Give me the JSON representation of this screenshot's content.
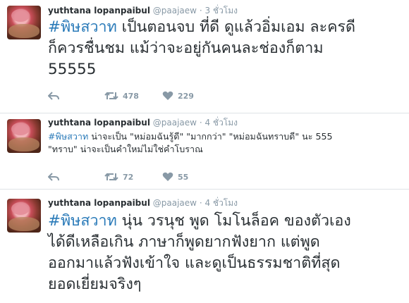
{
  "tweets": [
    {
      "name": "yuthtana lopanpaibul",
      "handle": "@paajaew",
      "time": "3 ชั่วโมง",
      "hashtag": "#พิษสวาท",
      "lines": [
        "เป็นตอนจบ ที่ดี ดูแล้วอิ่มเอม ละครดี",
        "ก็ควรชื่นชม แม้ว่าจะอยู่กันคนละช่องก็ตาม",
        "55555"
      ],
      "retweets": "478",
      "likes": "229",
      "icons": [
        "reply-icon",
        "retweet-icon",
        "heart-icon"
      ]
    },
    {
      "name": "yuthtana lopanpaibul",
      "handle": "@paajaew",
      "time": "4 ชั่วโมง",
      "hashtag": "#พิษสวาท",
      "lines": [
        "น่าจะเป็น \"หม่อมฉันรู้ดี\"  \"มากกว่า\" \"หม่อมฉันทราบดี\" นะ 555",
        "\"ทราบ\" น่าจะเป็นคำใหม่ไม่ใช่คำโบราณ"
      ],
      "retweets": "72",
      "likes": "55",
      "icons": [
        "reply-icon",
        "retweet-icon",
        "heart-icon"
      ]
    },
    {
      "name": "yuthtana lopanpaibul",
      "handle": "@paajaew",
      "time": "4 ชั่วโมง",
      "hashtag": "#พิษสวาท",
      "lines": [
        "นุ่น วรนุช พูด โมโนล็อค ของตัวเอง",
        "ได้ดีเหลือเกิน ภาษาก็พูดยากฟังยาก แต่พูด",
        "ออกมาแล้วฟังเข้าใจ และดูเป็นธรรมชาติที่สุด",
        "ยอดเยี่ยมจริงๆ"
      ]
    }
  ]
}
